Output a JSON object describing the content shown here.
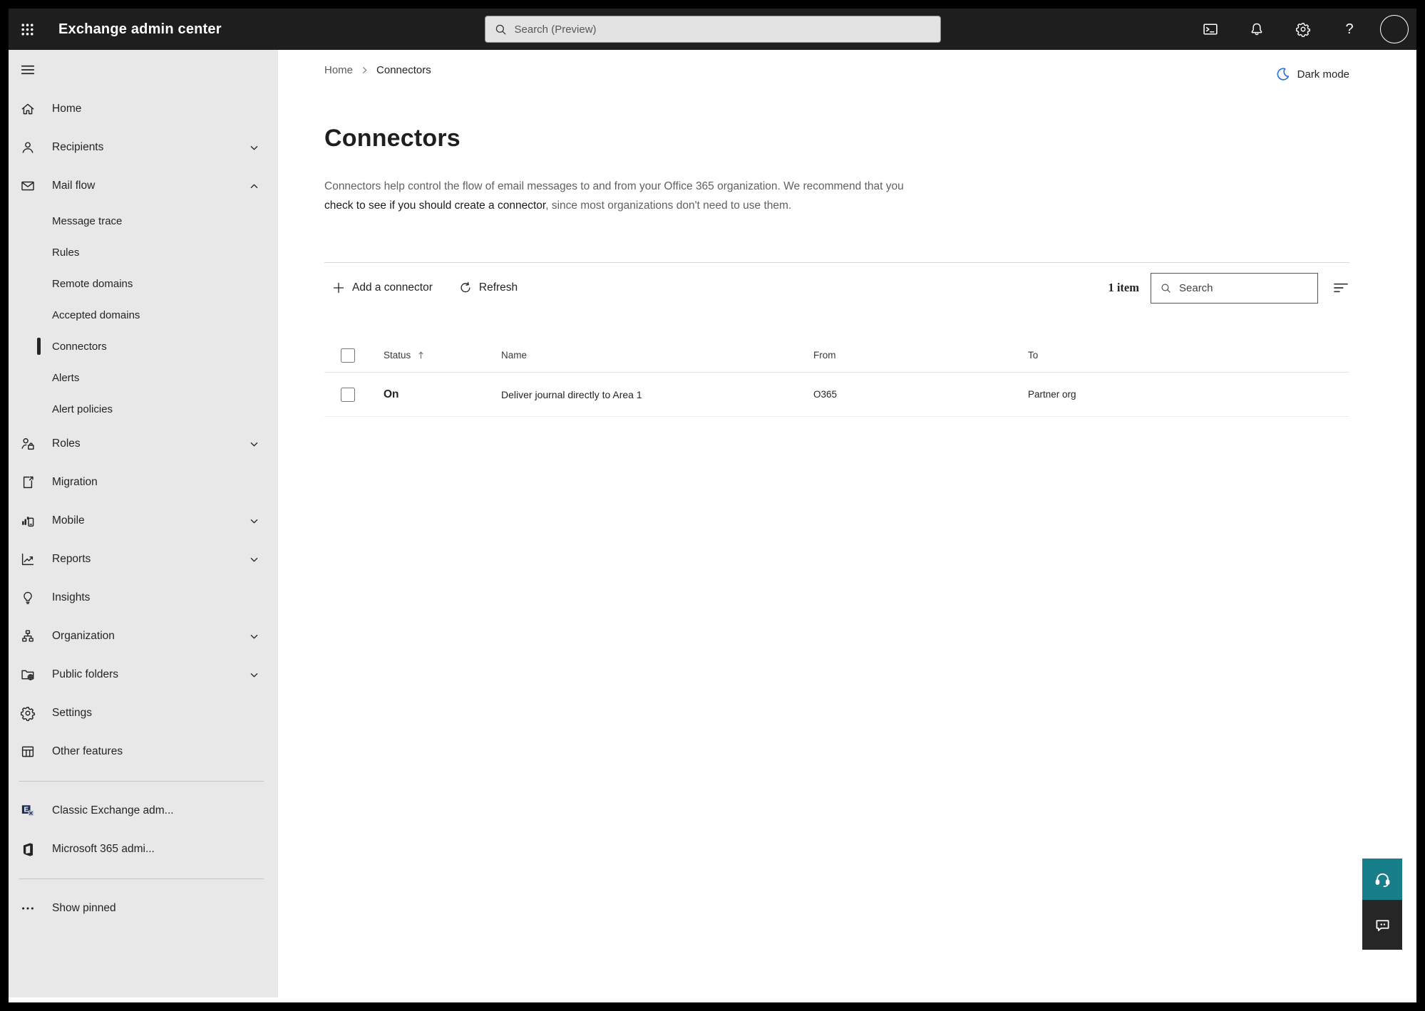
{
  "colors": {
    "topbar_bg": "#1f1e1e",
    "sidebar_bg": "#e8e8e8",
    "content_bg": "#ffffff",
    "text_primary": "#242424",
    "text_secondary": "#616161",
    "moon_blue": "#2f6fce",
    "help_teal": "#177e8a",
    "feedback_dark": "#262626",
    "selected_marker": "#242424"
  },
  "topbar": {
    "title": "Exchange admin center",
    "search_placeholder": "Search (Preview)",
    "help_glyph": "?",
    "icon_names": [
      "app-launcher-icon",
      "search-icon",
      "terminal-icon",
      "bell-icon",
      "gear-icon",
      "help-icon",
      "avatar"
    ]
  },
  "breadcrumb": {
    "items": [
      {
        "label": "Home"
      },
      {
        "label": "Connectors"
      }
    ]
  },
  "dark_mode": {
    "label": "Dark mode",
    "icon": "moon-icon"
  },
  "page": {
    "title": "Connectors",
    "description_pre": "Connectors help control the flow of email messages to and from your Office 365 organization. We recommend that you ",
    "description_link": "check to see if you should create a connector",
    "description_post": ", since most organizations don't need to use them."
  },
  "toolbar": {
    "add_button": "Add a connector",
    "refresh_button": "Refresh",
    "item_count": "1 item",
    "search_placeholder": "Search",
    "filter_icon": "filter-lines-icon"
  },
  "table": {
    "headers": {
      "status": "Status",
      "name": "Name",
      "from": "From",
      "to": "To"
    },
    "sorted_by": "Status",
    "sort_direction": "ascending",
    "rows": [
      {
        "status": "On",
        "name": "Deliver journal directly to Area 1",
        "from": "O365",
        "to": "Partner org",
        "checked": false
      }
    ]
  },
  "sidebar": {
    "items": [
      {
        "label": "Home",
        "icon": "home",
        "level": "top"
      },
      {
        "label": "Recipients",
        "icon": "person",
        "level": "top",
        "chevron": "down"
      },
      {
        "label": "Mail flow",
        "icon": "mail",
        "level": "top",
        "chevron": "up",
        "expanded": true
      },
      {
        "label": "Message trace",
        "level": "sub"
      },
      {
        "label": "Rules",
        "level": "sub"
      },
      {
        "label": "Remote domains",
        "level": "sub"
      },
      {
        "label": "Accepted domains",
        "level": "sub"
      },
      {
        "label": "Connectors",
        "level": "sub",
        "selected": true
      },
      {
        "label": "Alerts",
        "level": "sub"
      },
      {
        "label": "Alert policies",
        "level": "sub"
      },
      {
        "label": "Roles",
        "icon": "roles",
        "level": "top",
        "chevron": "down"
      },
      {
        "label": "Migration",
        "icon": "migration",
        "level": "top"
      },
      {
        "label": "Mobile",
        "icon": "mobile",
        "level": "top",
        "chevron": "down"
      },
      {
        "label": "Reports",
        "icon": "reports",
        "level": "top",
        "chevron": "down"
      },
      {
        "label": "Insights",
        "icon": "insights",
        "level": "top"
      },
      {
        "label": "Organization",
        "icon": "organization",
        "level": "top",
        "chevron": "down"
      },
      {
        "label": "Public folders",
        "icon": "public-folders",
        "level": "top",
        "chevron": "down"
      },
      {
        "label": "Settings",
        "icon": "gear",
        "level": "top"
      },
      {
        "label": "Other features",
        "icon": "table-grid",
        "level": "top"
      },
      {
        "type": "divider"
      },
      {
        "label": "Classic Exchange adm...",
        "icon": "exchange-logo",
        "level": "top"
      },
      {
        "label": "Microsoft 365 admi...",
        "icon": "m365-logo",
        "level": "top"
      },
      {
        "type": "divider"
      },
      {
        "label": "Show pinned",
        "icon": "ellipsis",
        "level": "top"
      }
    ]
  },
  "floating_buttons": [
    {
      "name": "help",
      "icon": "headset-icon"
    },
    {
      "name": "feedback",
      "icon": "chat-icon"
    }
  ]
}
